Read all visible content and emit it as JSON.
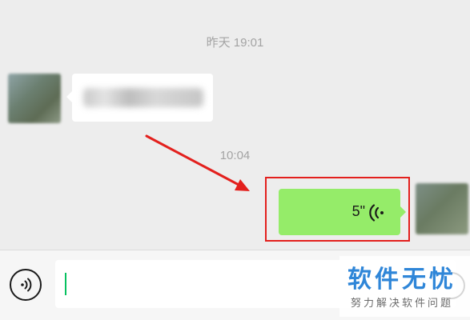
{
  "chat": {
    "timestamp_1": "昨天 19:01",
    "timestamp_2": "10:04",
    "incoming_message": {
      "avatar_icon": "blurred-avatar-icon"
    },
    "outgoing_voice_message": {
      "duration": "5\"",
      "icon": "voice-wave-icon",
      "bubble_color": "#95ec69",
      "highlight_color": "#e3201d"
    }
  },
  "input_bar": {
    "voice_toggle_icon": "voice-mode-icon",
    "input_value": "",
    "caret_color": "#07c160"
  },
  "watermark": {
    "title": "软件无忧",
    "subtitle": "努力解决软件问题",
    "color": "#2f86d8"
  },
  "annotation": {
    "arrow_color": "#e3201d"
  }
}
